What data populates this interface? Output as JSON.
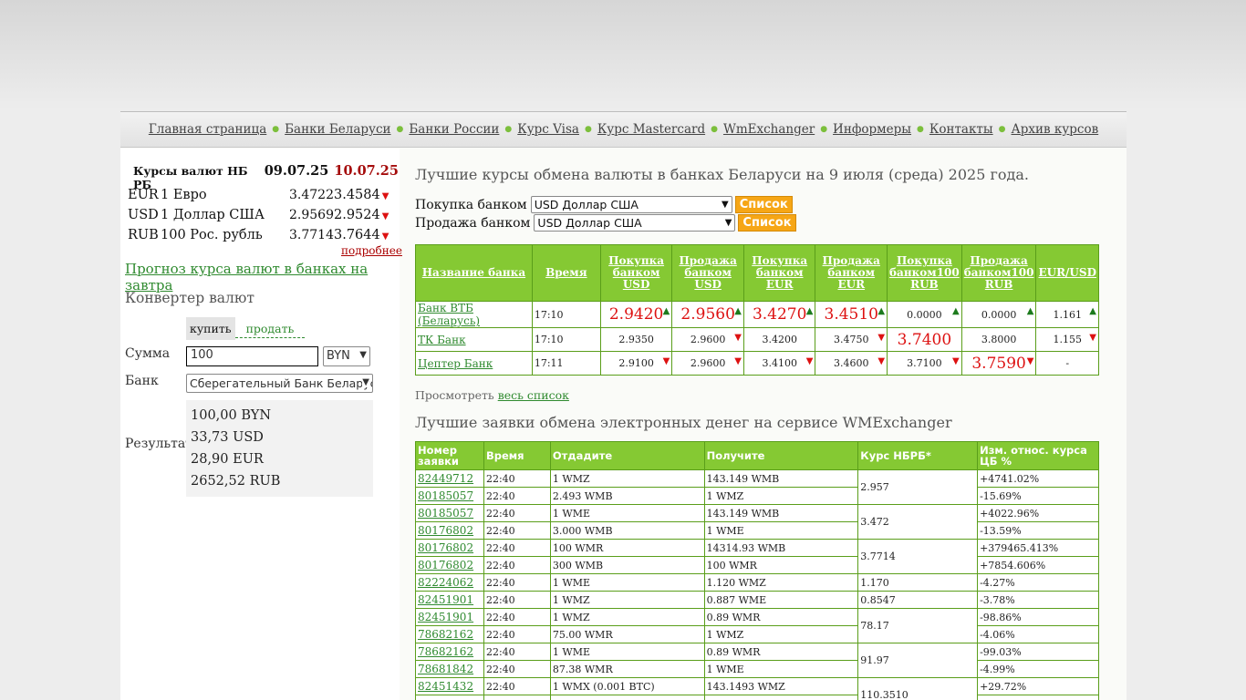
{
  "nav": [
    "Главная страница",
    "Банки Беларуси",
    "Банки России",
    "Курс Visa",
    "Курс Mastercard",
    "WmExchanger",
    "Информеры",
    "Контакты",
    "Архив курсов"
  ],
  "nbrb": {
    "title": "Курсы валют НБ РБ",
    "date1": "09.07.25",
    "date2": "10.07.25",
    "rows": [
      {
        "code": "EUR",
        "name": "1 Евро",
        "v1": "3.4722",
        "v2": "3.4584",
        "trend": "down"
      },
      {
        "code": "USD",
        "name": "1 Доллар США",
        "v1": "2.9569",
        "v2": "2.9524",
        "trend": "down"
      },
      {
        "code": "RUB",
        "name": "100 Рос. рубль",
        "v1": "3.7714",
        "v2": "3.7644",
        "trend": "down"
      }
    ],
    "more": "подробнее"
  },
  "forecast_link": "Прогноз курса валют в банках на завтра",
  "converter": {
    "title": "Конвертер валют",
    "tab_buy": "купить",
    "tab_sell": "продать",
    "amount_label": "Сумма",
    "amount_value": "100",
    "currency": "BYN",
    "bank_label": "Банк",
    "bank_value": "Сберегательный Банк Беларусбанк",
    "result_label": "Результат",
    "results": [
      "100,00 BYN",
      "33,73 USD",
      "28,90 EUR",
      "2652,52 RUB"
    ]
  },
  "main": {
    "heading": "Лучшие курсы обмена валюты в банках Беларуси на 9 июля (среда) 2025 года.",
    "buy_label": "Покупка банком",
    "buy_value": "USD Доллар США",
    "sell_label": "Продажа банком",
    "sell_value": "USD Доллар США",
    "list_btn": "Список",
    "view_prefix": "Просмотреть",
    "view_link": "весь список",
    "wm_heading": "Лучшие заявки обмена электронных денег на сервисе WMExchanger"
  },
  "rates_table": {
    "headers": [
      "Название банка",
      "Время",
      "Покупка банком USD",
      "Продажа банком USD",
      "Покупка банком EUR",
      "Продажа банком EUR",
      "Покупка банком100 RUB",
      "Продажа банком100 RUB",
      "EUR/USD"
    ],
    "rows": [
      {
        "bank": "Банк ВТБ (Беларусь)",
        "time": "17:10",
        "vals": [
          "2.9420",
          "2.9560",
          "3.4270",
          "3.4510",
          "0.0000",
          "0.0000",
          "1.161"
        ],
        "big": [
          true,
          true,
          true,
          true,
          false,
          false,
          false
        ],
        "arrows": [
          "up",
          "up",
          "up",
          "up",
          "up",
          "up",
          "up"
        ]
      },
      {
        "bank": "ТК Банк",
        "time": "17:10",
        "vals": [
          "2.9350",
          "2.9600",
          "3.4200",
          "3.4750",
          "3.7400",
          "3.8000",
          "1.155"
        ],
        "big": [
          false,
          false,
          false,
          false,
          true,
          false,
          false
        ],
        "arrows": [
          "",
          "down",
          "",
          "down",
          "",
          "",
          "down"
        ]
      },
      {
        "bank": "Цептер Банк",
        "time": "17:11",
        "vals": [
          "2.9100",
          "2.9600",
          "3.4100",
          "3.4600",
          "3.7100",
          "3.7590",
          "-"
        ],
        "big": [
          false,
          false,
          false,
          false,
          false,
          true,
          false
        ],
        "arrows": [
          "down",
          "down",
          "down",
          "down",
          "down",
          "down",
          ""
        ]
      }
    ]
  },
  "wm_table": {
    "headers": [
      "Номер заявки",
      "Время",
      "Отдадите",
      "Получите",
      "Курс НБРБ*",
      "Изм. относ. курса ЦБ %"
    ],
    "rows": [
      {
        "id": "82449712",
        "time": "22:40",
        "give": "1 WMZ",
        "get": "143.149 WMB",
        "rate": "2.957",
        "span": 2,
        "chg": "+4741.02%"
      },
      {
        "id": "80185057",
        "time": "22:40",
        "give": "2.493 WMB",
        "get": "1 WMZ",
        "chg": "-15.69%"
      },
      {
        "id": "80185057",
        "time": "22:40",
        "give": "1 WME",
        "get": "143.149 WMB",
        "rate": "3.472",
        "span": 2,
        "chg": "+4022.96%"
      },
      {
        "id": "80176802",
        "time": "22:40",
        "give": "3.000 WMB",
        "get": "1 WME",
        "chg": "-13.59%"
      },
      {
        "id": "80176802",
        "time": "22:40",
        "give": "100 WMR",
        "get": "14314.93 WMB",
        "rate": "3.7714",
        "span": 2,
        "chg": "+379465.413%"
      },
      {
        "id": "80176802",
        "time": "22:40",
        "give": "300 WMB",
        "get": "100 WMR",
        "chg": "+7854.606%"
      },
      {
        "id": "82224062",
        "time": "22:40",
        "give": "1 WME",
        "get": "1.120 WMZ",
        "rate": "1.170",
        "span": 1,
        "chg": "-4.27%"
      },
      {
        "id": "82451901",
        "time": "22:40",
        "give": "1 WMZ",
        "get": "0.887 WME",
        "rate": "0.8547",
        "span": 1,
        "chg": "-3.78%"
      },
      {
        "id": "82451901",
        "time": "22:40",
        "give": "1 WMZ",
        "get": "0.89 WMR",
        "rate": "78.17",
        "span": 2,
        "chg": "-98.86%"
      },
      {
        "id": "78682162",
        "time": "22:40",
        "give": "75.00 WMR",
        "get": "1 WMZ",
        "chg": "-4.06%"
      },
      {
        "id": "78682162",
        "time": "22:40",
        "give": "1 WME",
        "get": "0.89 WMR",
        "rate": "91.97",
        "span": 2,
        "chg": "-99.03%"
      },
      {
        "id": "78681842",
        "time": "22:40",
        "give": "87.38 WMR",
        "get": "1 WME",
        "chg": "-4.99%"
      },
      {
        "id": "82451432",
        "time": "22:40",
        "give": "1 WMX (0.001 BTC)",
        "get": "143.1493 WMZ",
        "rate": "110.3510",
        "span": 2,
        "chg": "+29.72%"
      },
      {
        "id": "",
        "time": "",
        "give": "",
        "get": "",
        "chg": ""
      }
    ]
  },
  "colors": {
    "accent_green": "#85c933",
    "link_green": "#2f8a2f",
    "red": "#d11111",
    "button_orange": "#f6a616"
  }
}
